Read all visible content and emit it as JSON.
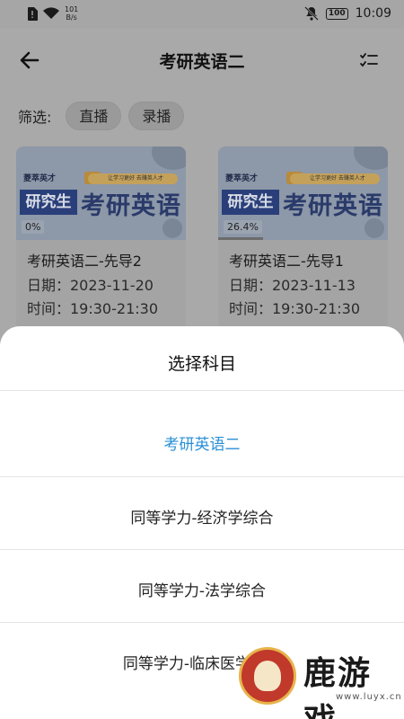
{
  "status_bar": {
    "network_speed_value": "101",
    "network_speed_unit": "B/s",
    "battery": "100",
    "time": "10:09"
  },
  "header": {
    "title": "考研英语二",
    "back_icon": "arrow-left-icon",
    "menu_icon": "checklist-icon"
  },
  "filter": {
    "label": "筛选:",
    "chips": [
      "直播",
      "录播"
    ]
  },
  "courses": [
    {
      "brand": "菱萃英才",
      "badge": "研究生",
      "banner": "考研英语",
      "tagline": "让学习更好  去赚英人才",
      "progress": "0%",
      "progress_value": 0,
      "title": "考研英语二-先导2",
      "date": "日期：2023-11-20",
      "time": "时间：19:30-21:30"
    },
    {
      "brand": "菱萃英才",
      "badge": "研究生",
      "banner": "考研英语",
      "tagline": "让学习更好  去赚英人才",
      "progress": "26.4%",
      "progress_value": 0.264,
      "title": "考研英语二-先导1",
      "date": "日期：2023-11-13",
      "time": "时间：19:30-21:30"
    }
  ],
  "sheet": {
    "title": "选择科目",
    "options": [
      {
        "label": "考研英语二",
        "selected": true
      },
      {
        "label": "同等学力-经济学综合",
        "selected": false
      },
      {
        "label": "同等学力-法学综合",
        "selected": false
      },
      {
        "label": "同等学力-临床医学综合",
        "selected": false
      }
    ]
  },
  "watermark": {
    "text": "鹿游戏",
    "sub": "www.luyx.cn"
  },
  "colors": {
    "accent_selected": "#2a8fd6",
    "overlay": "#a9a9a9",
    "sheet_bg": "#ffffff"
  }
}
